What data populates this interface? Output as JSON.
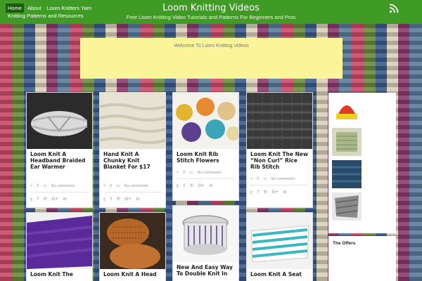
{
  "nav": {
    "items": [
      {
        "label": "Home",
        "active": true
      },
      {
        "label": "About",
        "active": false
      },
      {
        "label": "Loom Knitters Yarn",
        "active": false
      }
    ],
    "second_line": "Knitting Patterns and Resources"
  },
  "site": {
    "title": "Loom Knitting Videos",
    "tagline": "Free Loom Knitting Video Tutorials and Patterns For Beginners and Pros"
  },
  "welcome": {
    "text": "Welcome To Loom Knitting Videos"
  },
  "posts": [
    {
      "title": "Loom Knit A Headband Braided Ear Warmer",
      "likes": "0",
      "comments": "No comments"
    },
    {
      "title": "Hand Knit A Chunky Knit Blanket For $17",
      "likes": "0",
      "comments": "No comments"
    },
    {
      "title": "Loom Knit Rib Stitch Flowers",
      "likes": "0",
      "comments": "No comments"
    },
    {
      "title": "Loom Knit The New “Non Curl” Rice Rib Stitch",
      "likes": "0",
      "comments": "No comments"
    },
    {
      "title": "Loom Knit The",
      "likes": "",
      "comments": ""
    },
    {
      "title": "Loom Knit A Head",
      "likes": "",
      "comments": ""
    },
    {
      "title": "New And Easy Way To Double Knit In",
      "likes": "",
      "comments": ""
    },
    {
      "title": "Loom Knit A Seat",
      "likes": "",
      "comments": ""
    }
  ],
  "share_icons": [
    "twitter-icon",
    "facebook-icon",
    "pinterest-icon",
    "google-plus-icon",
    "linkedin-icon"
  ],
  "sidebar": {
    "offers_title": "The Offers"
  },
  "colors": {
    "header": "#3f9b26",
    "welcome_bg": "#fbf599",
    "card_bg": "#ffffff"
  }
}
